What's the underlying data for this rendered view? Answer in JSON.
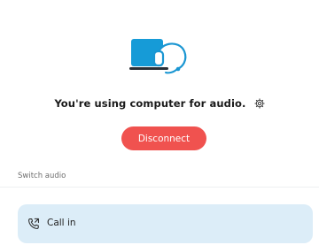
{
  "hero": {
    "icon": "laptop-headset-icon",
    "colors": {
      "laptop": "#169bd7",
      "outline": "#1a96d2",
      "base": "#2a2f36"
    }
  },
  "status": {
    "message": "You're using computer for audio.",
    "settings_icon": "gear-icon"
  },
  "disconnect_label": "Disconnect",
  "switch_audio": {
    "title": "Switch audio",
    "options": [
      {
        "label": "Call in",
        "icon": "phone-callin-icon"
      }
    ]
  },
  "colors": {
    "accent_red": "#f0524f",
    "option_bg": "#dcedf8"
  }
}
